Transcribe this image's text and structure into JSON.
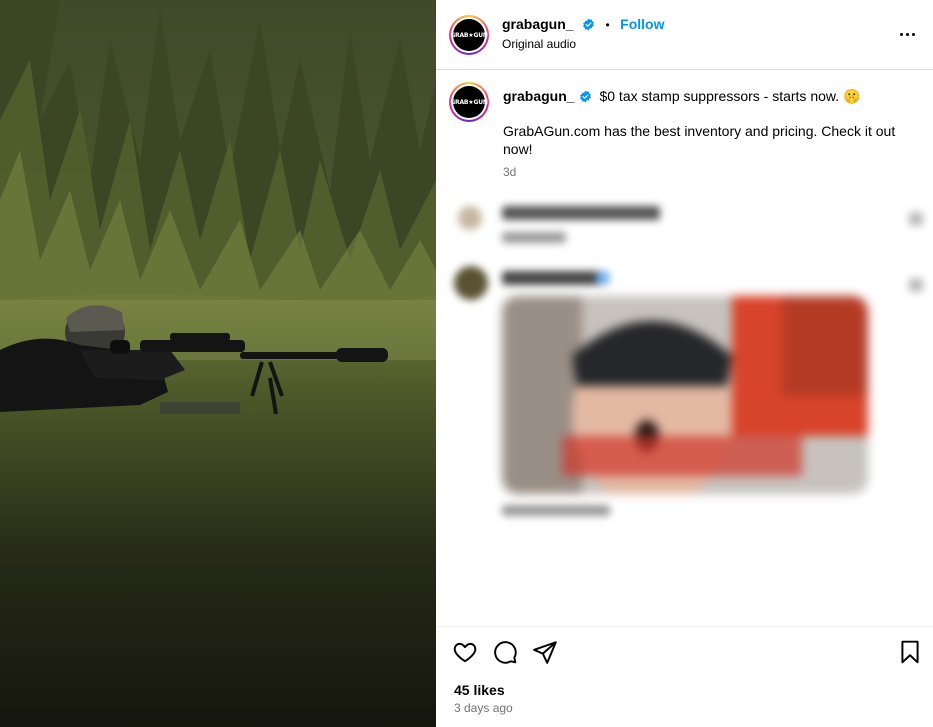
{
  "post": {
    "username": "grabagun_",
    "follow_label": "Follow",
    "subtitle": "Original audio",
    "avatar_text": "GRAB★GUN"
  },
  "caption": {
    "username": "grabagun_",
    "text": "$0 tax stamp suppressors - starts now. 🤫",
    "body": "GrabAGun.com has the best inventory and pricing. Check it out now!",
    "time": "3d"
  },
  "engagement": {
    "likes": "45 likes",
    "posted": "3 days ago"
  },
  "colors": {
    "accent": "#0095f6",
    "verified": "#0095f6",
    "muted": "#737373",
    "divider": "#dbdbdb"
  },
  "icons": [
    "verified-badge-icon",
    "more-options-icon",
    "heart-icon",
    "comment-icon",
    "share-icon",
    "bookmark-icon"
  ]
}
